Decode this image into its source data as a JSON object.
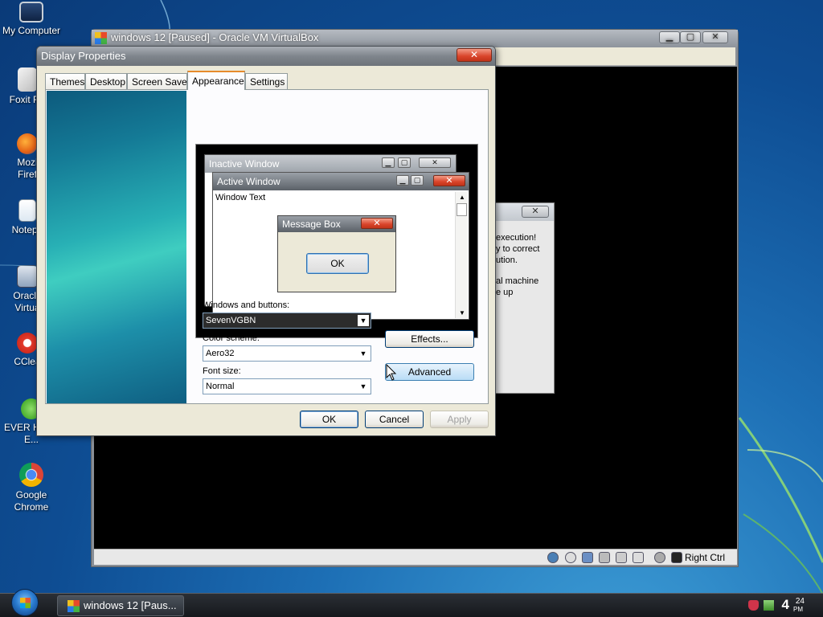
{
  "desktop": {
    "icons": [
      {
        "label": "My Computer"
      },
      {
        "label": "Foxit Re"
      },
      {
        "label": "Mozi Firef"
      },
      {
        "label": "Notepa"
      },
      {
        "label": "Oracle Virtua"
      },
      {
        "label": "CClea"
      },
      {
        "label": "EVER Home E..."
      },
      {
        "label": "Google Chrome"
      }
    ]
  },
  "vbox": {
    "title": "windows 12 [Paused] - Oracle VM VirtualBox",
    "statusbar": {
      "hostkey": "Right Ctrl"
    },
    "error_dialog": {
      "lines": [
        "execution!",
        "y to correct",
        "ution.",
        "",
        "al machine",
        "e up"
      ]
    }
  },
  "display_properties": {
    "title": "Display Properties",
    "tabs": [
      "Themes",
      "Desktop",
      "Screen Saver",
      "Appearance",
      "Settings"
    ],
    "active_tab": "Appearance",
    "preview": {
      "inactive_title": "Inactive Window",
      "active_title": "Active Window",
      "window_text": "Window Text",
      "msgbox_title": "Message Box",
      "msgbox_ok": "OK"
    },
    "windows_buttons_label": "Windows and buttons:",
    "windows_buttons_value": "SevenVGBN",
    "color_scheme_label": "Color scheme:",
    "color_scheme_value": "Aero32",
    "font_size_label": "Font size:",
    "font_size_value": "Normal",
    "effects_label": "Effects...",
    "advanced_label": "Advanced",
    "ok_label": "OK",
    "cancel_label": "Cancel",
    "apply_label": "Apply"
  },
  "taskbar": {
    "task_label": "windows 12 [Paus...",
    "clock_hour": "4",
    "clock_min": "24",
    "clock_ampm": "PM"
  }
}
